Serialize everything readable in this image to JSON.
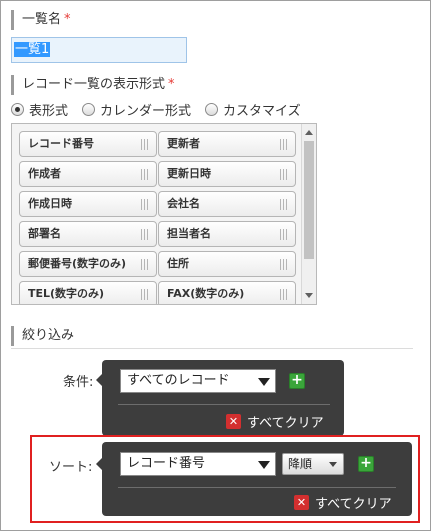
{
  "list_name": {
    "label": "一覧名",
    "required_mark": "*",
    "value": "一覧1"
  },
  "display_format": {
    "label": "レコード一覧の表示形式",
    "required_mark": "*",
    "options": [
      "表形式",
      "カレンダー形式",
      "カスタマイズ"
    ],
    "selected": "表形式"
  },
  "fields": [
    [
      "レコード番号",
      "更新者"
    ],
    [
      "作成者",
      "更新日時"
    ],
    [
      "作成日時",
      "会社名"
    ],
    [
      "部署名",
      "担当者名"
    ],
    [
      "郵便番号(数字のみ)",
      "住所"
    ],
    [
      "TEL(数字のみ)",
      "FAX(数字のみ)"
    ]
  ],
  "filter": {
    "heading": "絞り込み",
    "condition": {
      "label": "条件:",
      "value": "すべてのレコード",
      "add_label": "+",
      "clear_label": "すべてクリア"
    },
    "sort": {
      "label": "ソート:",
      "field_value": "レコード番号",
      "order_value": "降順",
      "add_label": "+",
      "clear_label": "すべてクリア"
    }
  },
  "colors": {
    "highlight": "#e02020",
    "panel_bg": "#3d3d3d",
    "add_green": "#3aa53a",
    "clear_red": "#d32f2f",
    "selection_blue": "#3399ff"
  }
}
